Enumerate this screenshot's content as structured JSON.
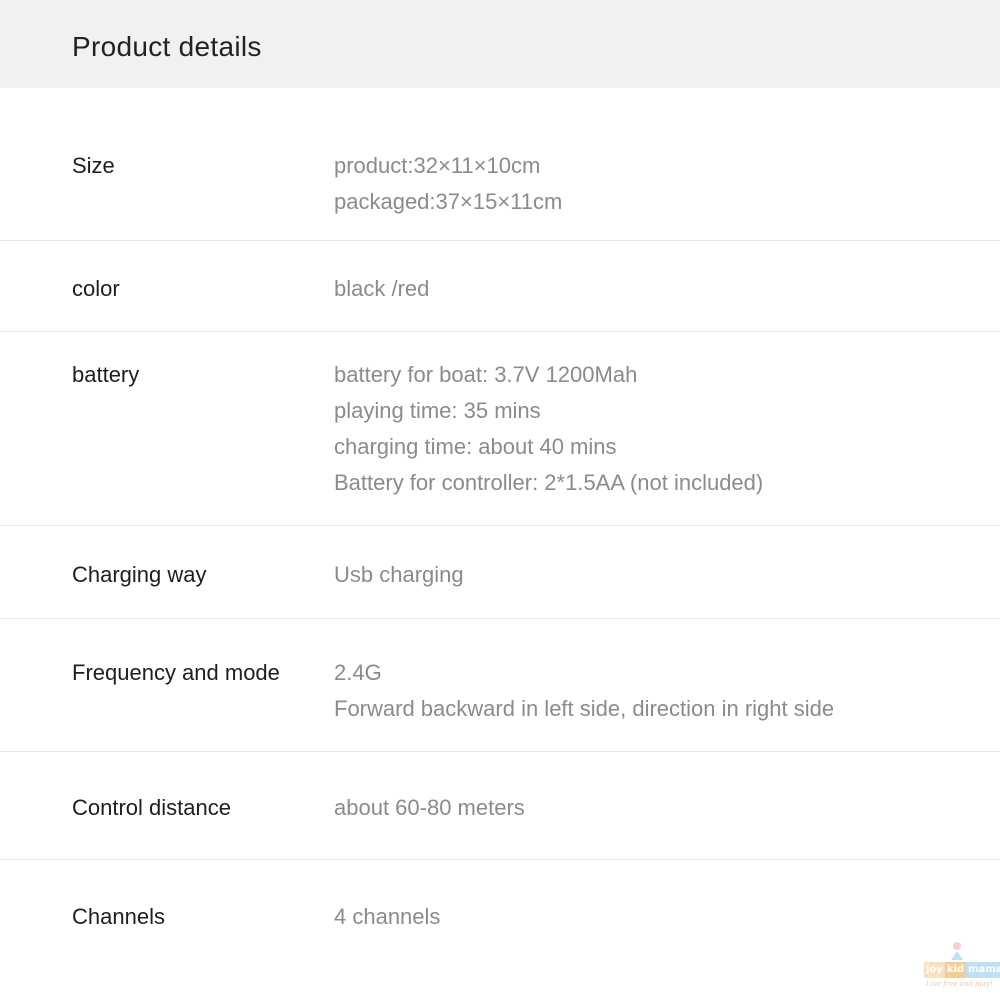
{
  "header": {
    "title": "Product details"
  },
  "rows": [
    {
      "label": "Size",
      "values": [
        "product:32×11×10cm",
        "packaged:37×15×11cm"
      ]
    },
    {
      "label": "color",
      "values": [
        "black /red"
      ]
    },
    {
      "label": "battery",
      "values": [
        "battery for boat: 3.7V 1200Mah",
        "playing time: 35 mins",
        "charging time: about 40 mins",
        "Battery for controller: 2*1.5AA (not included)"
      ]
    },
    {
      "label": "Charging way",
      "values": [
        "Usb charging"
      ]
    },
    {
      "label": "Frequency and mode",
      "values": [
        "2.4G",
        "Forward backward in left side, direction in right side"
      ]
    },
    {
      "label": "Control distance",
      "values": [
        "about 60-80 meters"
      ]
    },
    {
      "label": "Channels",
      "values": [
        "4 channels"
      ]
    }
  ],
  "watermark": {
    "parts": [
      "joy",
      "kid",
      "mama"
    ],
    "tagline": "Live free and play!",
    "icon": "child-figure-icon"
  },
  "colors": {
    "header_background": "#f1f1f2",
    "label_text": "#1e1e1e",
    "value_text": "#8b8b8b",
    "divider": "#e9e9e9"
  }
}
